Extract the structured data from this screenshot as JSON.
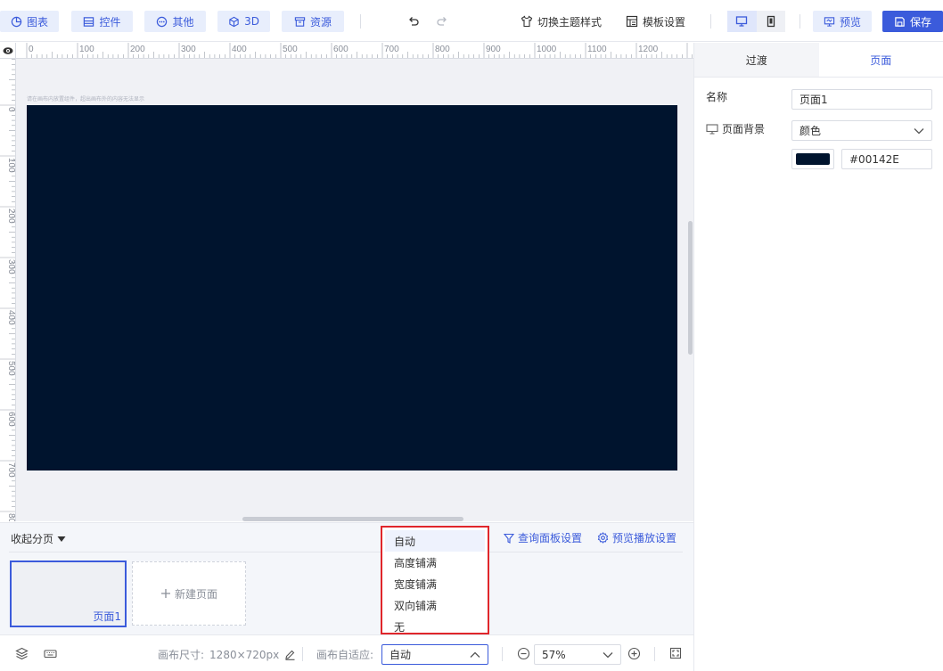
{
  "toolbar": {
    "chart_label": "图表",
    "widget_label": "控件",
    "other_label": "其他",
    "three_d_label": "3D",
    "resource_label": "资源",
    "theme_label": "切换主题样式",
    "template_label": "模板设置",
    "preview_label": "预览",
    "save_label": "保存"
  },
  "canvas": {
    "hint": "请在画布内放置组件，超出画布外的内容无法显示",
    "background": "#00142E",
    "ruler_top_labels": [
      "0",
      "100",
      "200",
      "300",
      "400",
      "500",
      "600",
      "700",
      "800",
      "900",
      "1000",
      "1100",
      "1200"
    ],
    "ruler_left_labels": [
      "0",
      "100",
      "200",
      "300",
      "400",
      "500",
      "600",
      "700",
      "800"
    ]
  },
  "right_panel": {
    "tabs": [
      {
        "label": "过渡"
      },
      {
        "label": "页面"
      }
    ],
    "name_label": "名称",
    "name_value": "页面1",
    "bg_label": "页面背景",
    "bg_type": "颜色",
    "color_hex": "#00142E"
  },
  "pages": {
    "collapse_label": "收起分页",
    "query_panel_label": "查询面板设置",
    "preview_play_label": "预览播放设置",
    "page1_name": "页面1",
    "new_page_label": "新建页面"
  },
  "bottombar": {
    "canvas_size_label": "画布尺寸:",
    "canvas_size_value": "1280×720px",
    "adapt_label": "画布自适应:",
    "adapt_value": "自动",
    "zoom_value": "57%"
  },
  "adapt_dropdown": {
    "options": [
      "自动",
      "高度铺满",
      "宽度铺满",
      "双向铺满",
      "无"
    ],
    "selected": "自动"
  },
  "colors": {
    "accent": "#3B5BDB",
    "highlight_border": "#E0262B"
  }
}
